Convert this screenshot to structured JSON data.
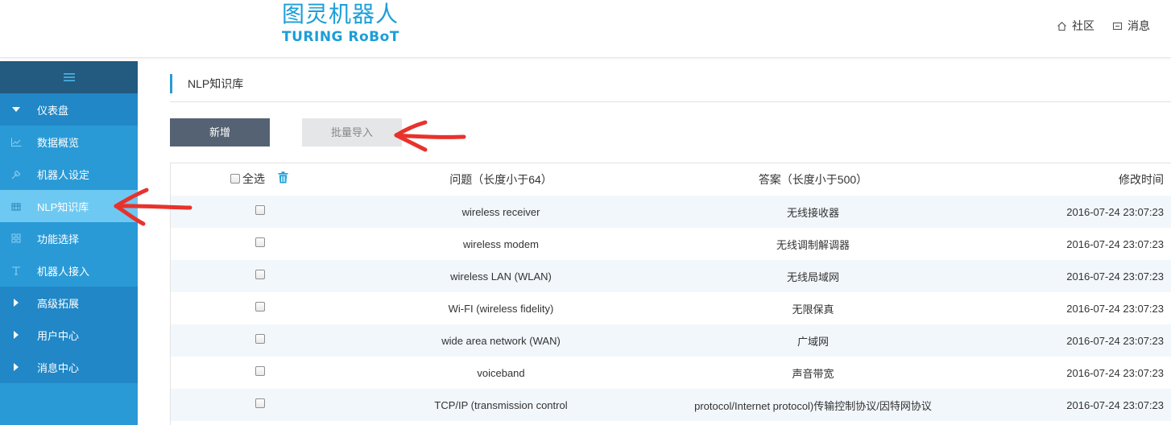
{
  "logo": {
    "cn": "图灵机器人",
    "en": "TURING RoBoT"
  },
  "top_links": [
    {
      "label": "社区",
      "icon": "home-icon"
    },
    {
      "label": "消息",
      "icon": "message-icon"
    }
  ],
  "sidebar": {
    "toggle_icon": "menu-icon",
    "items": [
      {
        "label": "仪表盘",
        "icon": "caret-down-icon"
      },
      {
        "label": "数据概览",
        "icon": "chart-line-icon"
      },
      {
        "label": "机器人设定",
        "icon": "wrench-icon"
      },
      {
        "label": "NLP知识库",
        "icon": "database-icon"
      },
      {
        "label": "功能选择",
        "icon": "grid-icon"
      },
      {
        "label": "机器人接入",
        "icon": "plug-icon"
      },
      {
        "label": "高级拓展",
        "icon": "caret-right-icon"
      },
      {
        "label": "用户中心",
        "icon": "caret-right-icon"
      },
      {
        "label": "消息中心",
        "icon": "caret-right-icon"
      }
    ]
  },
  "breadcrumb": "NLP知识库",
  "buttons": {
    "add": "新增",
    "import": "批量导入"
  },
  "table": {
    "select_all": "全选",
    "columns": [
      "问题（长度小于64）",
      "答案（长度小于500）",
      "修改时间"
    ],
    "rows": [
      {
        "q": "wireless receiver",
        "a": "无线接收器",
        "t": "2016-07-24 23:07:23"
      },
      {
        "q": "wireless modem",
        "a": "无线调制解调器",
        "t": "2016-07-24 23:07:23"
      },
      {
        "q": "wireless LAN (WLAN)",
        "a": "无线局域网",
        "t": "2016-07-24 23:07:23"
      },
      {
        "q": "Wi-FI (wireless fidelity)",
        "a": "无限保真",
        "t": "2016-07-24 23:07:23"
      },
      {
        "q": "wide area network (WAN)",
        "a": "广域网",
        "t": "2016-07-24 23:07:23"
      },
      {
        "q": "voiceband",
        "a": "声音带宽",
        "t": "2016-07-24 23:07:23"
      },
      {
        "q": "TCP/IP (transmission control",
        "a": "protocol/Internet protocol)传输控制协议/因特网协议",
        "t": "2016-07-24 23:07:23"
      }
    ]
  },
  "colors": {
    "brand": "#1b9ed8",
    "sidebar": "#2a9ad6",
    "sidebar_group": "#2187c6",
    "sidebar_toggle": "#235a80",
    "sidebar_active": "#6ec9f2",
    "add_button": "#556273",
    "annotation": "#e8322c"
  }
}
